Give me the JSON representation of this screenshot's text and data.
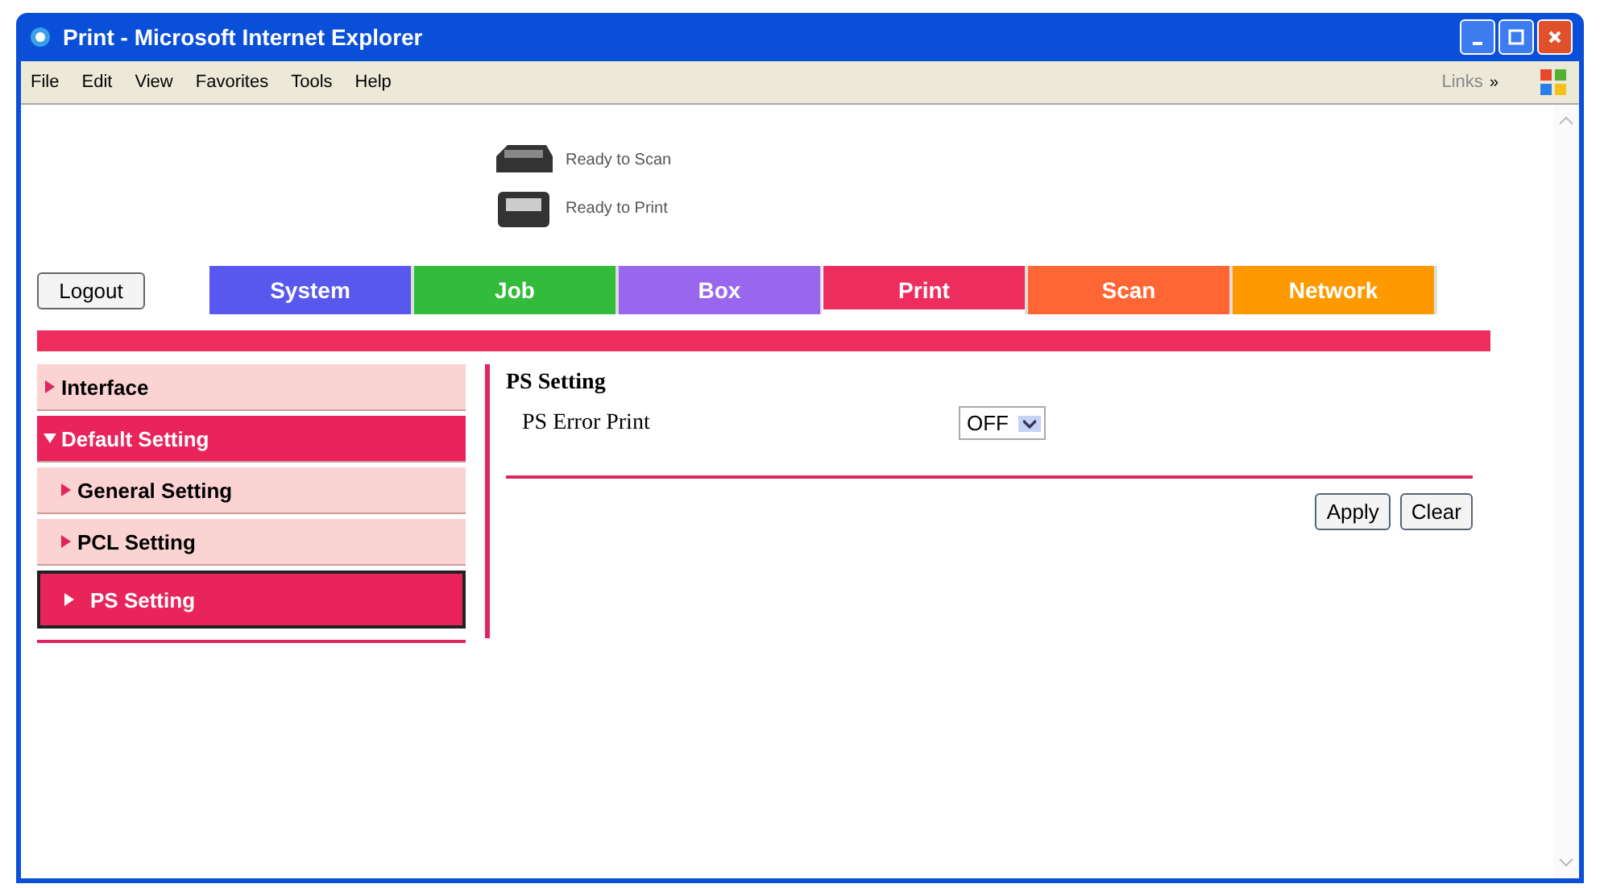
{
  "window": {
    "title": "Print - Microsoft Internet Explorer"
  },
  "menu": [
    "File",
    "Edit",
    "View",
    "Favorites",
    "Tools",
    "Help"
  ],
  "links": {
    "label": "Links",
    "chevron": "»"
  },
  "status": [
    {
      "kind": "scanner",
      "text": "Ready to Scan"
    },
    {
      "kind": "printer",
      "text": "Ready to Print"
    }
  ],
  "logout": "Logout",
  "tabs": [
    {
      "label": "System",
      "color": "#5858ee",
      "selected": false
    },
    {
      "label": "Job",
      "color": "#33bb3c",
      "selected": false
    },
    {
      "label": "Box",
      "color": "#9966ee",
      "selected": false
    },
    {
      "label": "Print",
      "color": "#ee2d5f",
      "selected": true
    },
    {
      "label": "Scan",
      "color": "#ff6633",
      "selected": false
    },
    {
      "label": "Network",
      "color": "#ff9900",
      "selected": false
    }
  ],
  "sidebar": {
    "items": [
      {
        "label": "Interface",
        "selected": false,
        "expanded": false
      },
      {
        "label": "Default Setting",
        "selected": false,
        "expanded": true,
        "children": [
          {
            "label": "General Setting",
            "selected": false
          },
          {
            "label": "PCL Setting",
            "selected": false
          },
          {
            "label": "PS Setting",
            "selected": true
          }
        ]
      }
    ]
  },
  "panel": {
    "heading": "PS Setting",
    "rows": [
      {
        "label": "PS Error Print",
        "value": "OFF"
      }
    ],
    "buttons": [
      "Apply",
      "Clear"
    ]
  }
}
